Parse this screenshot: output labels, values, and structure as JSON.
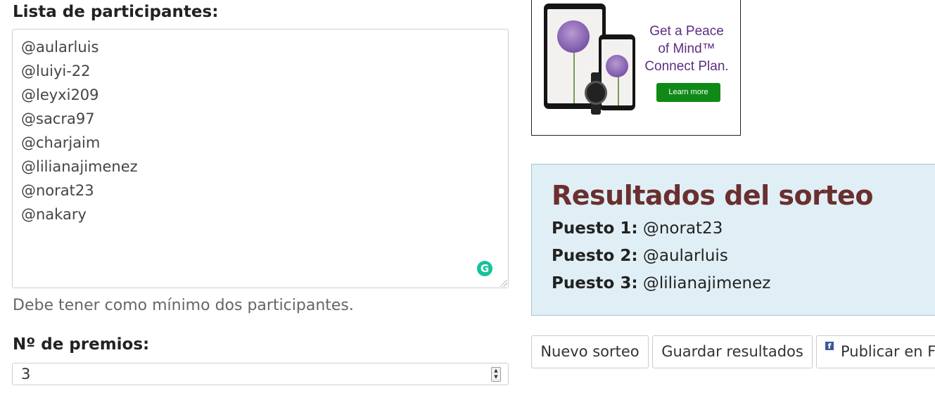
{
  "form": {
    "participants_label": "Lista de participantes:",
    "participants": [
      "@aularluis",
      "@luiyi-22",
      "@leyxi209",
      "@sacra97",
      "@charjaim",
      "@lilianajimenez",
      "@norat23",
      "@nakary"
    ],
    "helper_text": "Debe tener como mínimo dos participantes.",
    "prizes_label": "Nº de premios:",
    "prizes_value": "3"
  },
  "ad": {
    "headline_lines": [
      "Get a Peace",
      "of Mind™",
      "Connect Plan."
    ],
    "cta": "Learn more"
  },
  "results": {
    "title": "Resultados del sorteo",
    "rows": [
      {
        "label": "Puesto 1:",
        "value": "@norat23"
      },
      {
        "label": "Puesto 2:",
        "value": "@aularluis"
      },
      {
        "label": "Puesto 3:",
        "value": "@lilianajimenez"
      }
    ]
  },
  "actions": {
    "new_draw": "Nuevo sorteo",
    "save_results": "Guardar resultados",
    "publish": "Publicar en Facebook"
  },
  "icons": {
    "grammarly": "grammarly-icon",
    "facebook": "facebook-icon"
  },
  "colors": {
    "results_bg": "#e0eff5",
    "results_title": "#6b2f2f",
    "ad_purple": "#5d2d82",
    "ad_button": "#0f8a17",
    "grammarly": "#15c39a"
  }
}
